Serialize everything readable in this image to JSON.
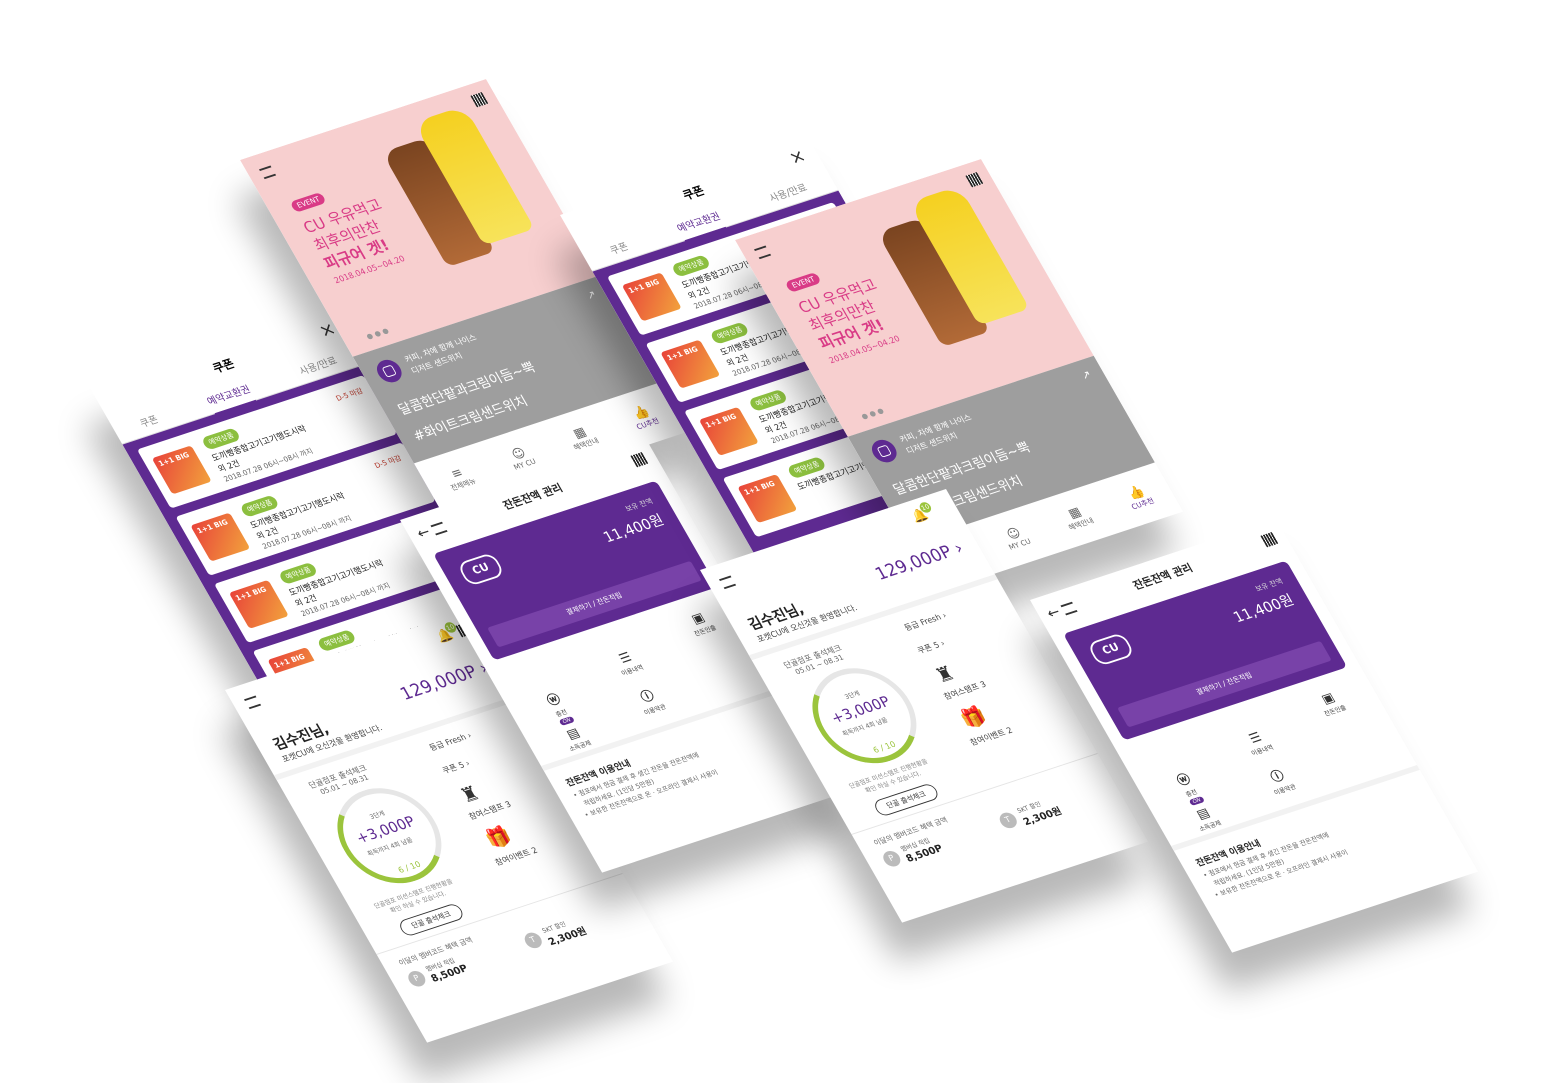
{
  "coupon": {
    "title": "쿠폰",
    "tabs": [
      "쿠폰",
      "예약교환권",
      "사용/만료"
    ],
    "items": [
      {
        "badge": "예약상품",
        "dday": "D-5 마감",
        "name": "도끼빵종합고기고기행도시락",
        "count": "외 2건",
        "date": "2018.07.28 06시~08시 까지",
        "img_label": "1+1 BIG"
      },
      {
        "badge": "예약상품",
        "dday": "D-5 마감",
        "name": "도끼빵종합고기고기행도시락",
        "count": "외 2건",
        "date": "2018.07.28 06시~08시 까지",
        "img_label": "1+1 BIG"
      },
      {
        "badge": "예약상품",
        "dday": "",
        "name": "도끼빵종합고기고기행도시락",
        "count": "외 2건",
        "date": "2018.07.28 06시~08시 까지",
        "img_label": "1+1 BIG"
      },
      {
        "badge": "예약상품",
        "dday": "",
        "name": "도끼빵종합고기고기행도시락",
        "count": "외 2건",
        "date": "2018.07.28 06시~08시 까지",
        "img_label": "1+1 BIG"
      }
    ]
  },
  "event": {
    "tag": "EVENT",
    "line1": "CU 우유먹고",
    "line2": "최후의만찬",
    "line3": "피규어 겟!",
    "date": "2018.04.05~04.20",
    "dots": "● ● ●",
    "insta_caption1": "커피, 차에 함께 나이스",
    "insta_caption2": "디저트 샌드위치",
    "insta_text1": "달콤한단팥과크림이듬~뿍",
    "insta_text2": "#화이트크림샌드위치",
    "nav": [
      {
        "icon": "≡",
        "label": "전체메뉴"
      },
      {
        "icon": "☺",
        "label": "MY CU"
      },
      {
        "icon": "▦",
        "label": "혜택안내"
      },
      {
        "icon": "👍",
        "label": "CU추천"
      }
    ]
  },
  "home": {
    "name": "김수진님,",
    "point": "129,000P ›",
    "welcome": "포켓CU에 오신것을 환영합니다.",
    "stamp_title": "단골점포 출석체크",
    "stamp_range": "05.01 ~ 08.31",
    "ring_step": "3단계",
    "ring_value": "+3,000P",
    "ring_sub": "획득까지 4회 남음",
    "ring_count": "6 / 10",
    "note1": "단골점포 미션스탬프 진행현황을",
    "note2": "확인 하실 수 있습니다.",
    "button": "단골 출석체크",
    "grade": "등급  Fresh  ›",
    "coupon": "쿠폰  5  ›",
    "stamp_label": "참여스탬프  3",
    "gift_label": "참여이벤트  2",
    "benefit_title": "이달의 멤버코드 혜택 금액",
    "p_icon": "P",
    "p_label": "멤버십 적립",
    "p_value": "8,500P",
    "skt_icon": "T",
    "skt_label": "SKT 할인",
    "skt_value": "2,300원",
    "bell_badge": "10"
  },
  "money": {
    "title": "잔돈잔액 관리",
    "logo": "CU",
    "balance_label": "보유 잔액",
    "balance": "11,400원",
    "action": "결제하기 / 잔돈적립",
    "icons": [
      {
        "icon": "▣",
        "label": "잔돈인출"
      },
      {
        "icon": "☰",
        "label": "이용내역"
      },
      {
        "icon": "ⓦ",
        "label": "충전"
      },
      {
        "icon": "ⓘ",
        "label": "이용약관"
      },
      {
        "icon": "▤",
        "label": "소득공제"
      }
    ],
    "on_label": "ON",
    "info_title": "잔돈잔액 이용안내",
    "info1": "• 점포에서 현금 결제 후 생긴 잔돈을 잔돈잔액에",
    "info2": "적립하세요. (1인당 5만원)",
    "info3": "• 보유한 잔돈잔액으로 온 · 오프라인 결제시 사용이"
  }
}
